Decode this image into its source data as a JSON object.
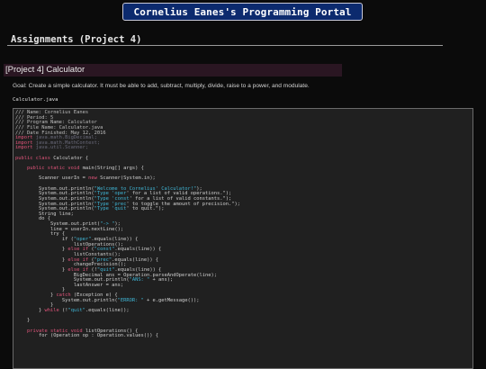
{
  "portal_title": "Cornelius Eanes's Programming Portal",
  "section_title": "Assignments (Project 4)",
  "project_heading": "[Project 4] Calculator",
  "goal_text": "Goal: Create a simple calculator. It must be able to add, subtract, multiply, divide, raise to a power, and modulate.",
  "file_name": "Calculator.java",
  "colors": {
    "header_bg": "#0c2a6e",
    "project_bar_bg": "#2a1622",
    "code_bg": "#202020",
    "keyword": "#e0547a",
    "string": "#3fb6d6",
    "comment": "#bcbcbc"
  },
  "code_lines": [
    [
      [
        "/// Name: Cornelius Eanes",
        "cm"
      ]
    ],
    [
      [
        "/// Period: 5",
        "cm"
      ]
    ],
    [
      [
        "/// Program Name: Calculator",
        "cm"
      ]
    ],
    [
      [
        "/// File Name: Calculator.java",
        "cm"
      ]
    ],
    [
      [
        "/// Date Finished: May 12, 2016",
        "cm"
      ]
    ],
    [
      [
        "import ",
        "kw"
      ],
      [
        "java.math.BigDecimal;",
        "im"
      ]
    ],
    [
      [
        "import ",
        "kw"
      ],
      [
        "java.math.MathContext;",
        "im"
      ]
    ],
    [
      [
        "import ",
        "kw"
      ],
      [
        "java.util.Scanner;",
        "im"
      ]
    ],
    [],
    [
      [
        "public class ",
        "kw"
      ],
      [
        "Calculator {",
        ""
      ]
    ],
    [],
    [
      [
        "    public static void ",
        "kw"
      ],
      [
        "main(String[] args) {",
        ""
      ]
    ],
    [],
    [
      [
        "        Scanner userIn = ",
        ""
      ],
      [
        "new ",
        "kw"
      ],
      [
        "Scanner(",
        ""
      ],
      [
        "System",
        ""
      ],
      [
        ".in);",
        ""
      ]
    ],
    [],
    [
      [
        "        System.out.println(",
        ""
      ],
      [
        "\"Welcome to Cornelius' Calculator!\"",
        ""
      ],
      [
        ");",
        ""
      ]
    ],
    [
      [
        "        System.out.println(",
        ""
      ],
      [
        "\"Type '",
        ""
      ],
      [
        "oper",
        ""
      ],
      [
        "' for a list of valid operations.\"",
        ""
      ],
      [
        ");",
        ""
      ]
    ],
    [
      [
        "        System.out.println(",
        ""
      ],
      [
        "\"Type '",
        ""
      ],
      [
        "const",
        ""
      ],
      [
        "' for a list of valid constants.\"",
        ""
      ],
      [
        ");",
        ""
      ]
    ],
    [
      [
        "        System.out.println(",
        ""
      ],
      [
        "\"Type '",
        ""
      ],
      [
        "prec",
        ""
      ],
      [
        "' to toggle the amount of precision.\"",
        ""
      ],
      [
        ");",
        ""
      ]
    ],
    [
      [
        "        System.out.println(",
        ""
      ],
      [
        "\"Type '",
        ""
      ],
      [
        "quit",
        ""
      ],
      [
        "' to quit.\"",
        ""
      ],
      [
        ");",
        ""
      ]
    ],
    [
      [
        "        String line;",
        ""
      ]
    ],
    [
      [
        "        do {",
        ""
      ]
    ],
    [
      [
        "            System.out.print(",
        ""
      ],
      [
        "\"-> \"",
        ""
      ],
      [
        ");",
        ""
      ]
    ],
    [
      [
        "            line = userIn.nextLine();",
        ""
      ]
    ],
    [
      [
        "            try {",
        ""
      ]
    ],
    [
      [
        "                if (",
        ""
      ],
      [
        "\"oper\"",
        ""
      ],
      [
        ".equals(line)) {",
        ""
      ]
    ],
    [
      [
        "                    listOperations();",
        ""
      ]
    ],
    [
      [
        "                } ",
        ""
      ],
      [
        "else if ",
        ""
      ],
      [
        "(",
        ""
      ],
      [
        "\"const\"",
        ""
      ],
      [
        ".equals(line)) {",
        ""
      ]
    ],
    [
      [
        "                    listConstants();",
        ""
      ]
    ],
    [
      [
        "                } ",
        ""
      ],
      [
        "else if ",
        ""
      ],
      [
        "(",
        ""
      ],
      [
        "\"prec\"",
        ""
      ],
      [
        ".equals(line)) {",
        ""
      ]
    ],
    [
      [
        "                    changePrecision();",
        ""
      ]
    ],
    [
      [
        "                } ",
        ""
      ],
      [
        "else if ",
        ""
      ],
      [
        "(!",
        ""
      ],
      [
        "\"quit\"",
        ""
      ],
      [
        ".equals(line)) {",
        ""
      ]
    ],
    [
      [
        "                    BigDecimal ans = Operation.parseAndOperate(line);",
        ""
      ]
    ],
    [
      [
        "                    System.out.println(",
        ""
      ],
      [
        "\"ANS: \"",
        ""
      ],
      [
        " + ans);",
        ""
      ]
    ],
    [
      [
        "                    lastAnswer = ans;",
        ""
      ]
    ],
    [
      [
        "                }",
        ""
      ]
    ],
    [
      [
        "            } ",
        ""
      ],
      [
        "catch ",
        ""
      ],
      [
        "(Exception e) {",
        ""
      ]
    ],
    [
      [
        "                System.out.println(",
        ""
      ],
      [
        "\"ERROR: \"",
        ""
      ],
      [
        " + e.getMessage());",
        ""
      ]
    ],
    [
      [
        "            }",
        ""
      ]
    ],
    [
      [
        "        } ",
        ""
      ],
      [
        "while ",
        ""
      ],
      [
        "(!",
        ""
      ],
      [
        "\"quit\"",
        ""
      ],
      [
        ".equals(line));",
        ""
      ]
    ],
    [],
    [
      [
        "    }",
        ""
      ]
    ],
    [],
    [
      [
        "    private static void ",
        ""
      ],
      [
        "listOperations() {",
        ""
      ]
    ],
    [
      [
        "        for (Operation op : Operation.values()) {",
        ""
      ]
    ]
  ]
}
